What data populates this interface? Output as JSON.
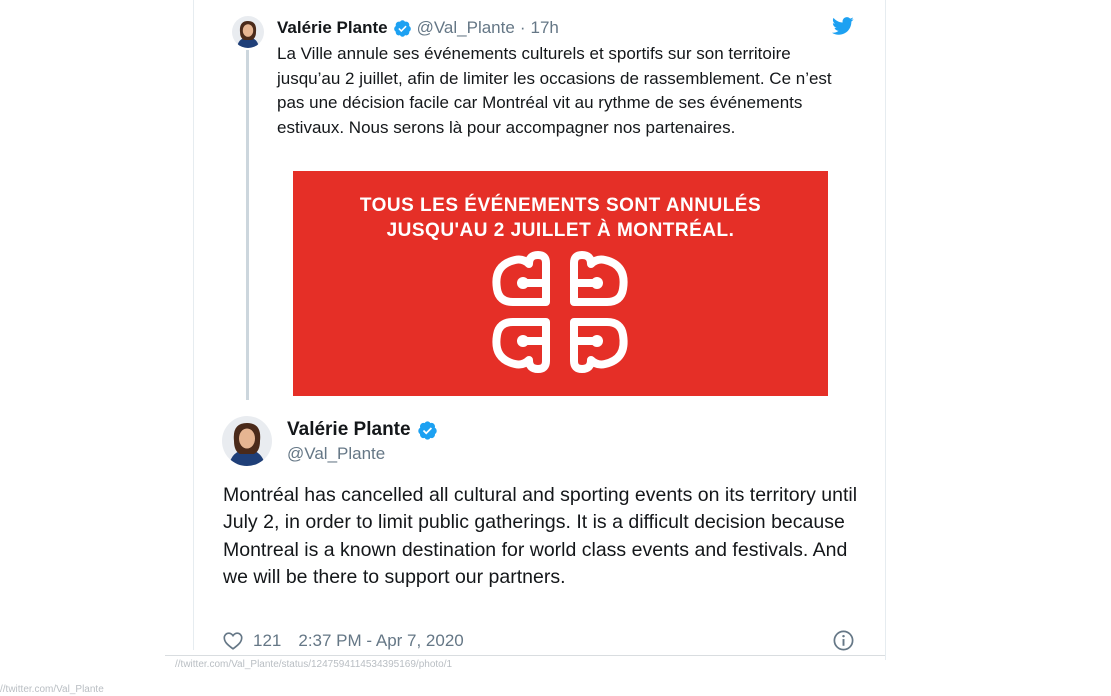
{
  "quoted_tweet": {
    "author_name": "Valérie Plante",
    "handle": "@Val_Plante",
    "separator": "·",
    "time": "17h",
    "text": "La Ville annule ses événements culturels et sportifs sur son territoire jusqu’au 2 juillet, afin de limiter les occasions de rassemblement. Ce n’est pas une décision facile car Montréal vit au rythme de ses événements estivaux. Nous serons là pour accompagner nos partenaires.",
    "media": {
      "line1": "TOUS LES ÉVÉNEMENTS SONT ANNULÉS",
      "line2": "JUSQU'AU 2 JUILLET À MONTRÉAL.",
      "background_color": "#e52f27"
    },
    "icon": "twitter-bird-icon"
  },
  "main_tweet": {
    "author_name": "Valérie Plante",
    "handle": "@Val_Plante",
    "text": "Montréal has cancelled all cultural and sporting events on its territory until July 2, in order to limit public gatherings. It is a difficult decision because Montreal is a known destination for world class events and festivals. And we will be there to support our partners.",
    "likes": "121",
    "timestamp": "2:37 PM - Apr 7, 2020"
  },
  "source": {
    "url_fragment_1": "//twitter.com/Val_Plante/status/1247594114534395169/photo/1",
    "url_fragment_2": "//twitter.com/Val_Plante"
  },
  "colors": {
    "accent": "#1da1f2",
    "secondary_text": "#657786",
    "thread_line": "#ccd6dd"
  }
}
